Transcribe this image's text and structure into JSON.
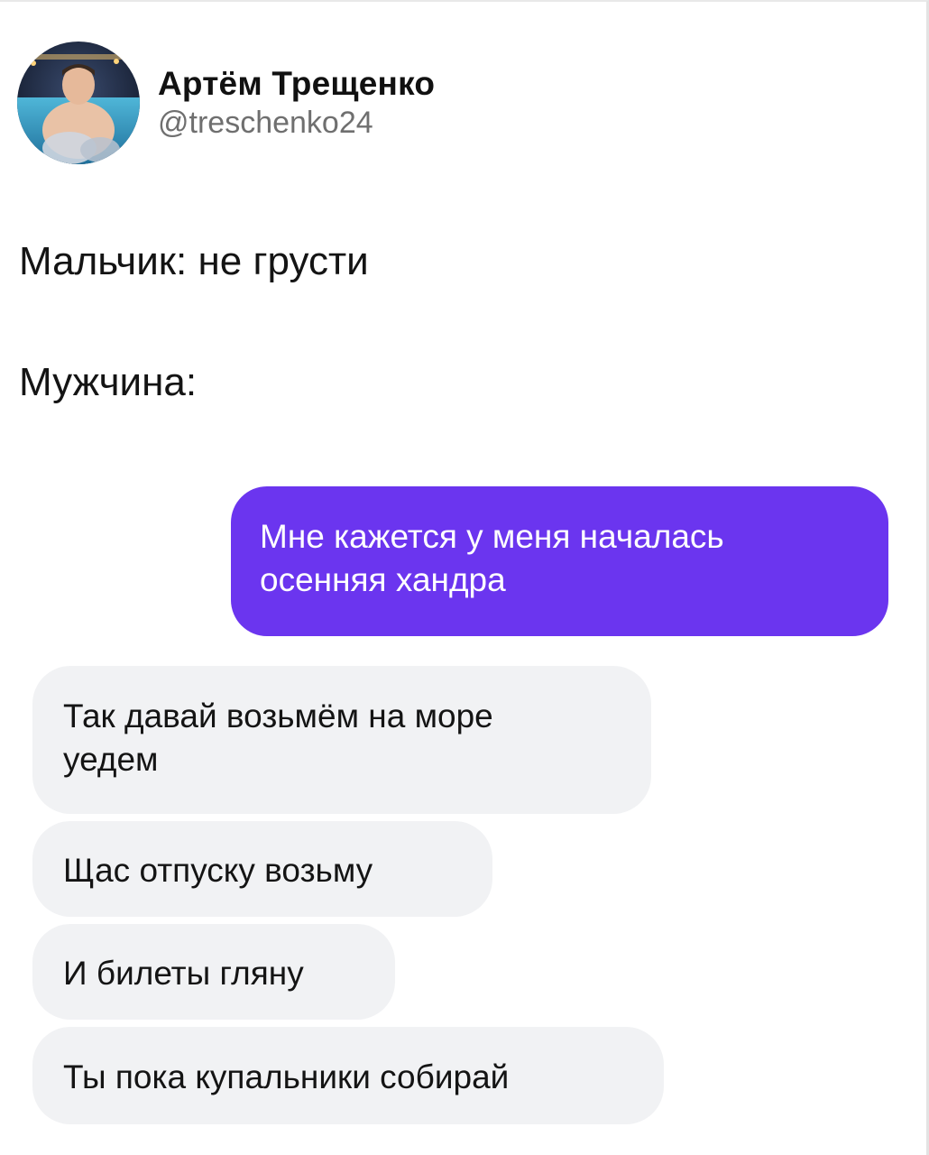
{
  "post": {
    "author": {
      "display_name": "Артём Трещенко",
      "handle": "@treschenko24",
      "avatar_icon": "avatar-photo"
    },
    "text_lines": [
      "Мальчик: не грусти",
      "Мужчина:"
    ]
  },
  "chat": {
    "outgoing": {
      "lines": [
        "Мне кажется у меня началась",
        "осенняя хандра"
      ],
      "color": "#6b35ef"
    },
    "incoming": [
      {
        "lines": [
          "Так давай возьмём на море",
          "уедем"
        ]
      },
      {
        "lines": [
          "Щас отпуску возьму"
        ]
      },
      {
        "lines": [
          "И билеты гляну"
        ]
      },
      {
        "lines": [
          "Ты пока купальники собирай"
        ]
      }
    ],
    "incoming_color": "#f1f2f4"
  }
}
